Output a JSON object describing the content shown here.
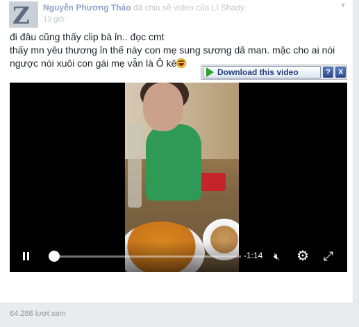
{
  "post": {
    "author": "Nguyễn Phương Thảo",
    "action": "đã chia sẻ video của Lí Shady",
    "time": "13 giờ",
    "text_lines": [
      "đi đâu cũng thấy clip bà ỉn.. đọc cmt",
      "thấy mn yêu thương ỉn thế này con mẹ sung sương dã man. mặc cho ai nói",
      "ngược nói xuôi con gái mẹ vẫn là Ô kê"
    ],
    "menu_icon": "chevron-down-icon",
    "emoji_icon": "laughing-tears-emoji"
  },
  "download_bar": {
    "button_label": "Download this video",
    "help_label": "?",
    "close_label": "X",
    "accent": "#2aa12a"
  },
  "video": {
    "time_remaining": "-1:14",
    "progress": 0.02,
    "icons": [
      "pause-icon",
      "volume-mute-icon",
      "gear-icon",
      "fullscreen-icon"
    ]
  },
  "footer": {
    "views": "64.288 lượt xem"
  },
  "colors": {
    "link": "#365899",
    "meta": "#90949c",
    "background": "#e9ebee"
  }
}
